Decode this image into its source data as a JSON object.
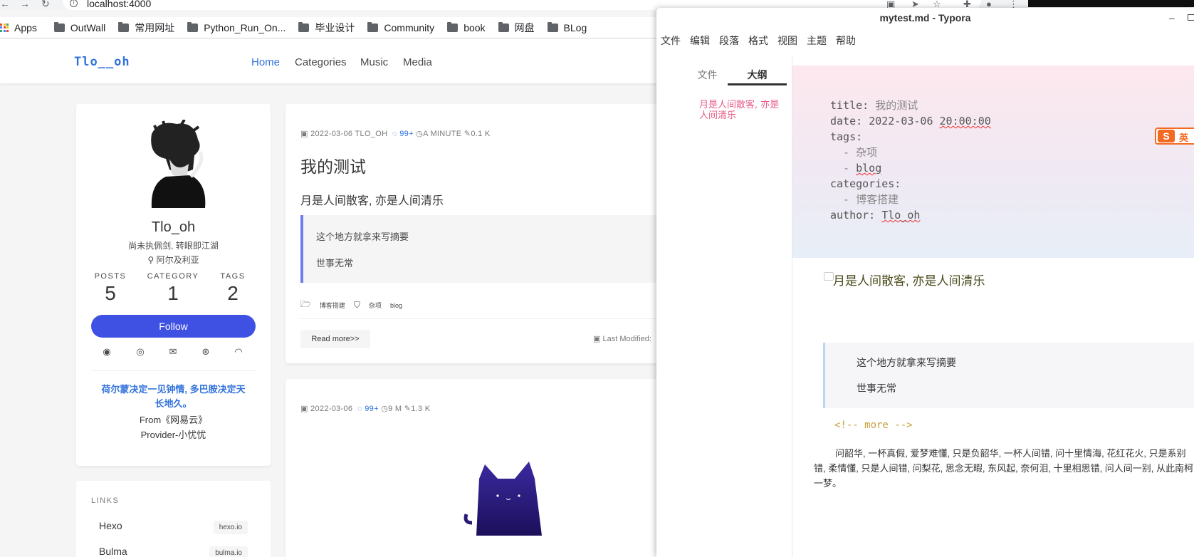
{
  "browser": {
    "url": "localhost:4000",
    "bookmarks": [
      {
        "label": "Apps",
        "type": "apps"
      },
      {
        "label": "OutWall",
        "type": "folder"
      },
      {
        "label": "常用网址",
        "type": "folder"
      },
      {
        "label": "Python_Run_On...",
        "type": "folder"
      },
      {
        "label": "毕业设计",
        "type": "folder"
      },
      {
        "label": "Community",
        "type": "folder"
      },
      {
        "label": "book",
        "type": "folder"
      },
      {
        "label": "网盘",
        "type": "folder"
      },
      {
        "label": "BLog",
        "type": "folder"
      }
    ]
  },
  "blog": {
    "logo": "Tlo__oh",
    "nav": [
      "Home",
      "Categories",
      "Music",
      "Media"
    ],
    "accent": "#3f51e3",
    "profile": {
      "name": "Tlo_oh",
      "motto": "尚未执佩剑, 转眼即江湖",
      "location": "阿尔及利亚",
      "stats": [
        {
          "label": "POSTS",
          "value": "5"
        },
        {
          "label": "CATEGORY",
          "value": "1"
        },
        {
          "label": "TAGS",
          "value": "2"
        }
      ],
      "follow": "Follow",
      "song_quote": "荷尔蒙决定一见钟情, 多巴胺决定天长地久。",
      "song_from": "From《网易云》",
      "song_provider": "Provider-小忧忧"
    },
    "links": {
      "title": "LINKS",
      "items": [
        {
          "name": "Hexo",
          "tag": "hexo.io"
        },
        {
          "name": "Bulma",
          "tag": "bulma.io"
        }
      ]
    },
    "posts": [
      {
        "date": "2022-03-06",
        "author": "TLO_OH",
        "comments": "99+",
        "time": "A MINUTE",
        "words": "0.1 K",
        "title": "我的测试",
        "subtitle": "月是人间散客, 亦是人间清乐",
        "quote_lines": [
          "这个地方就拿来写摘要",
          "世事无常"
        ],
        "category": "博客搭建",
        "tags": [
          "杂项",
          "blog"
        ],
        "read_more": "Read more>>",
        "last_modified": "Last Modified:"
      },
      {
        "date": "2022-03-06",
        "comments": "99+",
        "time": "9 M",
        "words": "1.3 K"
      }
    ]
  },
  "typora": {
    "title": "mytest.md - Typora",
    "menu": [
      "文件",
      "编辑",
      "段落",
      "格式",
      "视图",
      "主题",
      "帮助"
    ],
    "sidebar_tabs": [
      "文件",
      "大纲"
    ],
    "outline_item": "月是人间散客, 亦是人间清乐",
    "front_matter": {
      "title_key": "title: ",
      "title_val": "我的测试",
      "date_key": "date: ",
      "date_val": "2022-03-06 ",
      "date_time": "20:00:00",
      "tags_key": "tags:",
      "tag1": "  - 杂项",
      "tag2_prefix": "  - ",
      "tag2": "blog",
      "categories_key": "categories:",
      "cat1": "  - 博客搭建",
      "author_key": "author: ",
      "author_val": "Tlo_oh"
    },
    "ime": {
      "logo": "S",
      "mode": "英"
    },
    "heading": "月是人间散客, 亦是人间清乐",
    "quote_lines": [
      "这个地方就拿来写摘要",
      "世事无常"
    ],
    "more_comment": "<!-- more -->",
    "paragraph": "问韶华, 一杯真假, 爱梦难懂, 只是负韶华, 一杯人间错, 问十里情海, 花红花火, 只是系别错, 柔情懂, 只是人间错, 问梨花, 思念无暇, 东风起, 奈何泪, 十里相思错, 问人间一别, 从此南柯一梦。"
  }
}
